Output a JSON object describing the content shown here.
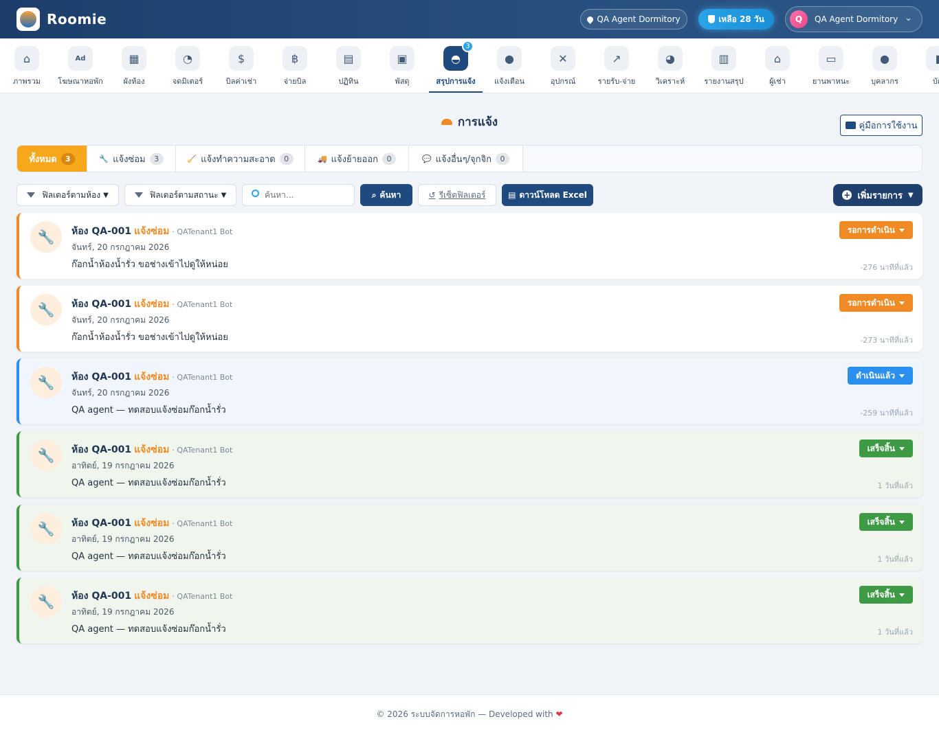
{
  "header": {
    "brand": "Roomie",
    "dormitory": "QA Agent Dormitory",
    "days_left": "เหลือ 28 วัน",
    "user_initial": "Q",
    "user_name": "QA Agent Dormitory"
  },
  "nav": {
    "items": [
      {
        "label": "ภาพรวม",
        "icon": "home-icon",
        "glyph": "⌂"
      },
      {
        "label": "โฆษณาหอพัก",
        "icon": "ad-icon",
        "glyph": "Ad"
      },
      {
        "label": "ผังห้อง",
        "icon": "grid-icon",
        "glyph": "▦"
      },
      {
        "label": "จดมิเตอร์",
        "icon": "meter-icon",
        "glyph": "◔"
      },
      {
        "label": "บิลค่าเช่า",
        "icon": "invoice-icon",
        "glyph": "$"
      },
      {
        "label": "จ่ายบิล",
        "icon": "cash-icon",
        "glyph": "฿"
      },
      {
        "label": "ปฏิทิน",
        "icon": "calendar-icon",
        "glyph": "▤"
      },
      {
        "label": "พัสดุ",
        "icon": "boxes-icon",
        "glyph": "▣"
      },
      {
        "label": "สรุปการแจ้ง",
        "icon": "bell-icon",
        "glyph": "◓",
        "badge": "3",
        "active": true
      },
      {
        "label": "แจ้งเตือน",
        "icon": "chat-icon",
        "glyph": "●"
      },
      {
        "label": "อุปกรณ์",
        "icon": "tools-icon",
        "glyph": "✕"
      },
      {
        "label": "รายรับ-จ่าย",
        "icon": "chart-line-icon",
        "glyph": "↗"
      },
      {
        "label": "วิเคราะห์",
        "icon": "pie-chart-icon",
        "glyph": "◕"
      },
      {
        "label": "รายงานสรุป",
        "icon": "report-icon",
        "glyph": "▥"
      },
      {
        "label": "ผู้เช่า",
        "icon": "tenants-icon",
        "glyph": "⌂"
      },
      {
        "label": "ยานพาหนะ",
        "icon": "car-icon",
        "glyph": "▭"
      },
      {
        "label": "บุคลากร",
        "icon": "person-icon",
        "glyph": "●"
      },
      {
        "label": "บัญ",
        "icon": "account-icon",
        "glyph": "▮"
      }
    ]
  },
  "page": {
    "title": "การแจ้ง",
    "manual_label": "คู่มือการใช้งาน"
  },
  "tabs": [
    {
      "label": "ทั้งหมด",
      "count": "3",
      "icon": "",
      "active": true
    },
    {
      "label": "แจ้งซ่อม",
      "count": "3",
      "icon": "🔧"
    },
    {
      "label": "แจ้งทำความสะอาด",
      "count": "0",
      "icon": "🧹"
    },
    {
      "label": "แจ้งย้ายออก",
      "count": "0",
      "icon": "🚚"
    },
    {
      "label": "แจ้งอื่นๆ/จุกจิก",
      "count": "0",
      "icon": "💬"
    }
  ],
  "filters": {
    "room_filter": "ฟิลเตอร์ตามห้อง",
    "status_filter": "ฟิลเตอร์ตามสถานะ",
    "search_placeholder": "ค้นหา...",
    "search_button": "ค้นหา",
    "reset_button": "รีเซ็ตฟิลเตอร์",
    "download_button": "ดาวน์โหลด Excel",
    "add_button": "เพิ่มรายการ"
  },
  "requests": [
    {
      "room": "ห้อง QA-001",
      "type": "แจ้งซ่อม",
      "reporter": "· QATenant1 Bot",
      "date": "จันทร์, 20 กรกฎาคม 2026",
      "message": "ก๊อกน้ำห้องน้ำรั่ว ขอช่างเข้าไปดูให้หน่อย",
      "status": "รอการดำเนิน",
      "status_kind": "pending",
      "time": "-276 นาทีที่แล้ว"
    },
    {
      "room": "ห้อง QA-001",
      "type": "แจ้งซ่อม",
      "reporter": "· QATenant1 Bot",
      "date": "จันทร์, 20 กรกฎาคม 2026",
      "message": "ก๊อกน้ำห้องน้ำรั่ว ขอช่างเข้าไปดูให้หน่อย",
      "status": "รอการดำเนิน",
      "status_kind": "pending",
      "time": "-273 นาทีที่แล้ว"
    },
    {
      "room": "ห้อง QA-001",
      "type": "แจ้งซ่อม",
      "reporter": "· QATenant1 Bot",
      "date": "จันทร์, 20 กรกฎาคม 2026",
      "message": "QA agent — ทดสอบแจ้งซ่อมก๊อกน้ำรั่ว",
      "status": "ดำเนินแล้ว",
      "status_kind": "progress",
      "time": "-259 นาทีที่แล้ว"
    },
    {
      "room": "ห้อง QA-001",
      "type": "แจ้งซ่อม",
      "reporter": "· QATenant1 Bot",
      "date": "อาทิตย์, 19 กรกฎาคม 2026",
      "message": "QA agent — ทดสอบแจ้งซ่อมก๊อกน้ำรั่ว",
      "status": "เสร็จสิ้น",
      "status_kind": "done",
      "time": "1 วันที่แล้ว"
    },
    {
      "room": "ห้อง QA-001",
      "type": "แจ้งซ่อม",
      "reporter": "· QATenant1 Bot",
      "date": "อาทิตย์, 19 กรกฎาคม 2026",
      "message": "QA agent — ทดสอบแจ้งซ่อมก๊อกน้ำรั่ว",
      "status": "เสร็จสิ้น",
      "status_kind": "done",
      "time": "1 วันที่แล้ว"
    },
    {
      "room": "ห้อง QA-001",
      "type": "แจ้งซ่อม",
      "reporter": "· QATenant1 Bot",
      "date": "อาทิตย์, 19 กรกฎาคม 2026",
      "message": "QA agent — ทดสอบแจ้งซ่อมก๊อกน้ำรั่ว",
      "status": "เสร็จสิ้น",
      "status_kind": "done",
      "time": "1 วันที่แล้ว"
    }
  ],
  "footer": {
    "text": "© 2026 ระบบจัดการหอพัก — Developed with",
    "heart": "❤"
  },
  "colors": {
    "header": "#1d3e6b",
    "primary": "#1f4a7e",
    "pending": "#f08a24",
    "progress": "#2b8ff0",
    "done": "#3f9a45",
    "active_tab": "#f7a71c"
  }
}
